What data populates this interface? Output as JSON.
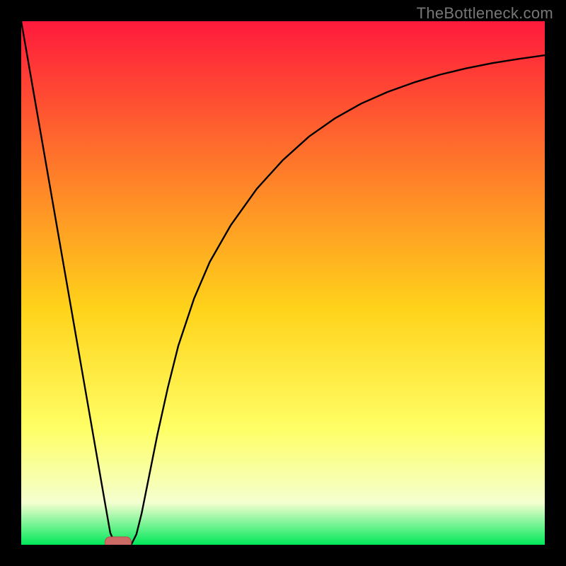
{
  "watermark": "TheBottleneck.com",
  "colors": {
    "frame": "#000000",
    "gradient_top": "#ff1a3c",
    "gradient_upper_mid": "#ff7a2a",
    "gradient_mid": "#ffd31a",
    "gradient_lower_mid": "#ffff66",
    "gradient_pale": "#f4ffd0",
    "gradient_bottom": "#00e85a",
    "curve": "#000000",
    "marker_fill": "#cc6a66",
    "marker_stroke": "#b84f4f"
  },
  "chart_data": {
    "type": "line",
    "title": "",
    "xlabel": "",
    "ylabel": "",
    "xlim": [
      0,
      100
    ],
    "ylim": [
      0,
      100
    ],
    "grid": false,
    "legend": false,
    "annotations": [],
    "series": [
      {
        "name": "bottleneck-curve",
        "x": [
          0,
          2,
          4,
          6,
          8,
          10,
          12,
          14,
          16,
          17,
          18,
          19,
          20,
          21,
          22,
          23,
          24,
          25,
          26,
          28,
          30,
          33,
          36,
          40,
          45,
          50,
          55,
          60,
          65,
          70,
          75,
          80,
          85,
          90,
          95,
          100
        ],
        "y": [
          100,
          88.5,
          77,
          65.5,
          54,
          42.5,
          31,
          19.5,
          8,
          2.3,
          0,
          0,
          0,
          0,
          2,
          6,
          11,
          16,
          21,
          30,
          38,
          47,
          54,
          61,
          68,
          73.5,
          78,
          81.5,
          84.3,
          86.5,
          88.3,
          89.8,
          91,
          92,
          92.8,
          93.5
        ]
      }
    ],
    "marker": {
      "x": 18.5,
      "y": 0,
      "w": 5,
      "h": 2.2
    }
  }
}
